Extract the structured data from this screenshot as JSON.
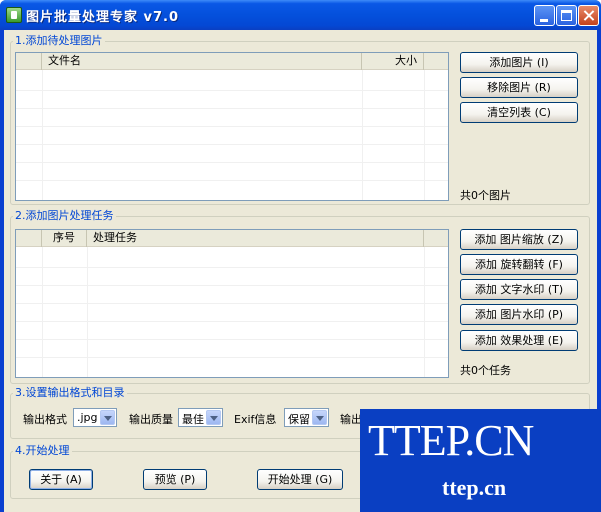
{
  "window": {
    "title": "图片批量处理专家 v7.0"
  },
  "groups": {
    "images": {
      "title": "1.添加待处理图片",
      "columns": [
        "",
        "文件名",
        "大小",
        ""
      ],
      "buttons": [
        "添加图片 (I)",
        "移除图片 (R)",
        "清空列表 (C)"
      ],
      "count": "共0个图片"
    },
    "tasks": {
      "title": "2.添加图片处理任务",
      "columns": [
        "",
        "序号",
        "处理任务",
        ""
      ],
      "buttons": [
        "添加 图片缩放 (Z)",
        "添加 旋转翻转 (F)",
        "添加 文字水印 (T)",
        "添加 图片水印 (P)",
        "添加 效果处理 (E)"
      ],
      "count": "共0个任务"
    },
    "output": {
      "title": "3.设置输出格式和目录",
      "format_label": "输出格式",
      "format_value": ".jpg",
      "quality_label": "输出质量",
      "quality_value": "最佳",
      "exif_label": "Exif信息",
      "exif_value": "保留",
      "dir_label": "输出"
    },
    "start": {
      "title": "4.开始处理",
      "buttons": [
        "关于 (A)",
        "预览 (P)",
        "开始处理 (G)"
      ]
    }
  },
  "watermark": {
    "big": "TTEP.CN",
    "small": "ttep.cn"
  }
}
